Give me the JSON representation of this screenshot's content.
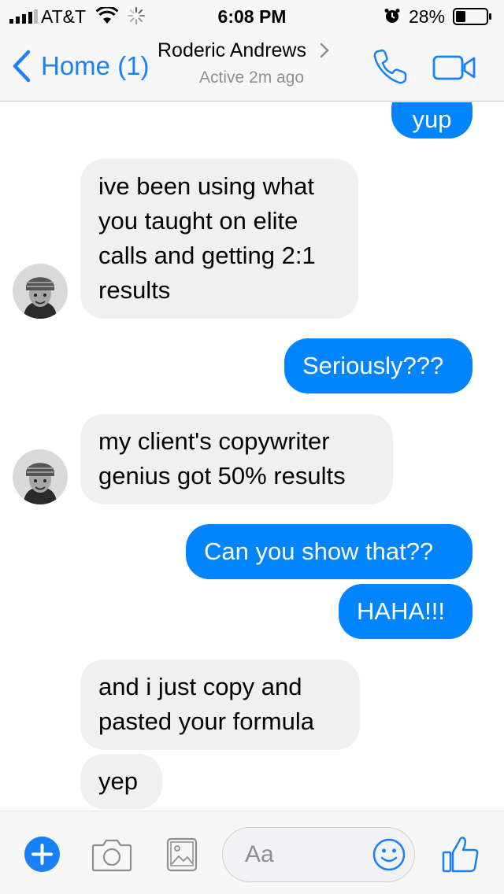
{
  "status_bar": {
    "carrier": "AT&T",
    "time": "6:08 PM",
    "battery": "28%",
    "icons": [
      "signal-icon",
      "wifi-icon",
      "activity-spinner-icon",
      "alarm-icon",
      "battery-icon"
    ]
  },
  "nav": {
    "back_label": "Home (1)",
    "contact_name": "Roderic Andrews",
    "contact_status": "Active 2m ago",
    "accent": "#1a80f5"
  },
  "messages": [
    {
      "sender": "me",
      "text": "yup"
    },
    {
      "sender": "contact",
      "lines": [
        "ive been using what",
        "you taught on elite",
        "calls and getting 2:1",
        "results"
      ]
    },
    {
      "sender": "me",
      "text": "Seriously???"
    },
    {
      "sender": "contact",
      "lines": [
        "my client's copywriter",
        "genius got 50% results"
      ]
    },
    {
      "sender": "me",
      "text": "Can you show that??"
    },
    {
      "sender": "me",
      "text": "HAHA!!!"
    },
    {
      "sender": "contact",
      "lines": [
        "and i just copy and",
        "pasted your formula"
      ]
    },
    {
      "sender": "contact",
      "text": "yep"
    }
  ],
  "colors": {
    "outgoing_bubble": "#0084ff",
    "incoming_bubble": "#f1f0f0"
  },
  "composer": {
    "placeholder": "Aa",
    "icons": [
      "plus-icon",
      "camera-icon",
      "gallery-icon",
      "emoji-icon",
      "thumbs-up-icon"
    ]
  }
}
